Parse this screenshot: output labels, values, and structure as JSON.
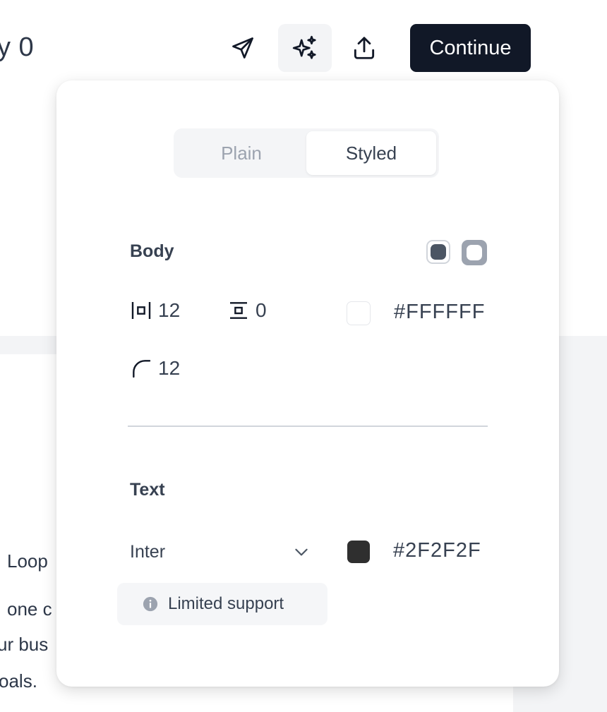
{
  "page": {
    "title_fragment": "y 0",
    "body_fragments": [
      "Loop",
      "one c",
      "ur bus",
      "oals."
    ]
  },
  "toolbar": {
    "send_icon": "send-icon",
    "ai_icon": "sparkles-icon",
    "share_icon": "upload-icon",
    "continue_label": "Continue"
  },
  "style_panel": {
    "mode_options": [
      "Plain",
      "Styled"
    ],
    "selected_mode": "Styled",
    "body": {
      "title": "Body",
      "padding": "12",
      "spacing": "0",
      "radius": "12",
      "background_hex": "#FFFFFF",
      "background_color": "#FFFFFF"
    },
    "text": {
      "title": "Text",
      "font": "Inter",
      "color_hex": "#2F2F2F",
      "color": "#2F2F2F",
      "support_note": "Limited support"
    }
  }
}
